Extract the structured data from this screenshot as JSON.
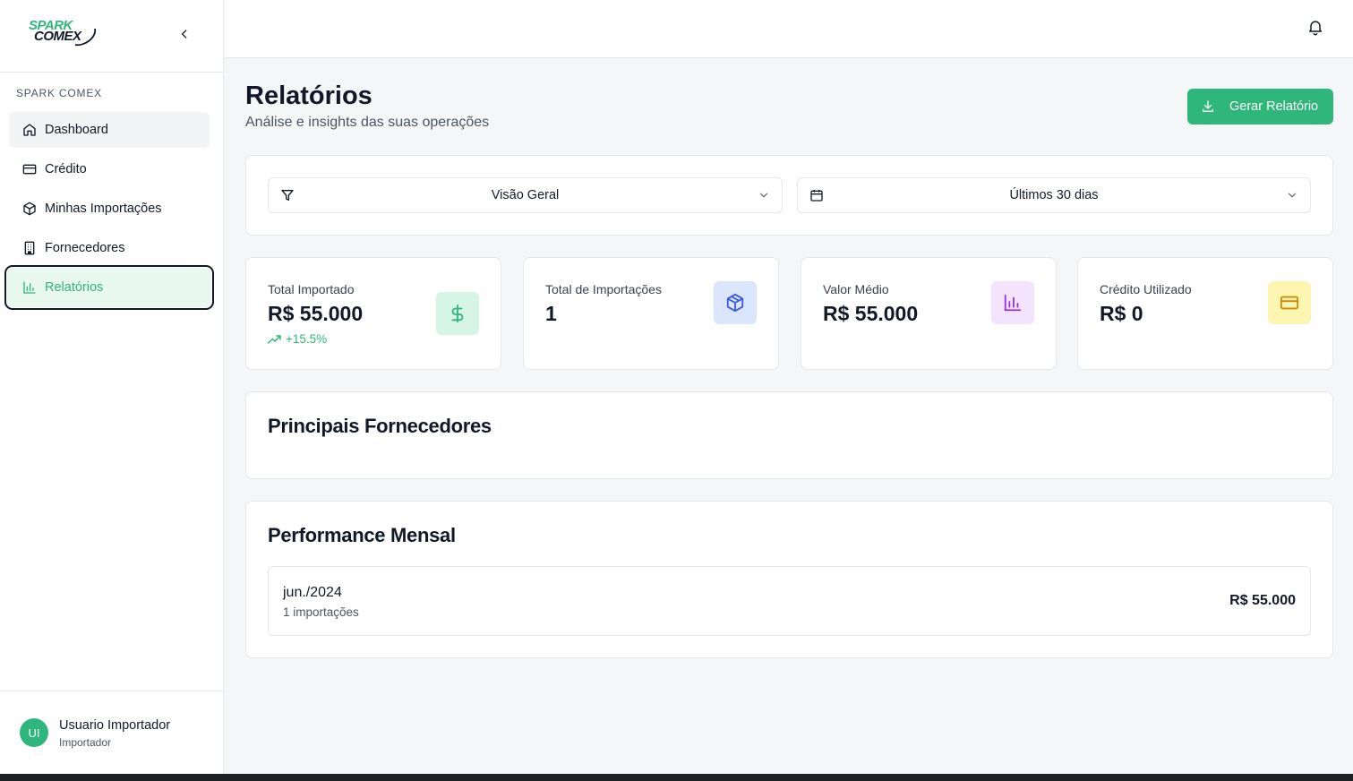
{
  "sidebar": {
    "logo": {
      "line1": "SPARK",
      "line2": "COMEX"
    },
    "section_label": "SPARK COMEX",
    "items": [
      {
        "label": "Dashboard",
        "icon": "home-icon"
      },
      {
        "label": "Crédito",
        "icon": "credit-card-icon"
      },
      {
        "label": "Minhas Importações",
        "icon": "package-icon"
      },
      {
        "label": "Fornecedores",
        "icon": "building-icon"
      },
      {
        "label": "Relatórios",
        "icon": "bar-chart-icon",
        "active": true
      }
    ],
    "user": {
      "initials": "UI",
      "name": "Usuario Importador",
      "role": "Importador"
    }
  },
  "header": {
    "title": "Relatórios",
    "subtitle": "Análise e insights das suas operações",
    "generate_label": "Gerar Relatório"
  },
  "filters": {
    "view": "Visão Geral",
    "period": "Últimos 30 dias"
  },
  "stats": [
    {
      "label": "Total Importado",
      "value": "R$ 55.000",
      "trend": "+15.5%",
      "icon": "dollar-icon",
      "color": "#d6f5e5"
    },
    {
      "label": "Total de Importações",
      "value": "1",
      "icon": "package-icon",
      "color": "#dbe6fd"
    },
    {
      "label": "Valor Médio",
      "value": "R$ 55.000",
      "icon": "bar-chart-icon",
      "color": "#f3e3fc"
    },
    {
      "label": "Crédito Utilizado",
      "value": "R$ 0",
      "icon": "credit-card-icon",
      "color": "#fdf6b2"
    }
  ],
  "suppliers": {
    "title": "Principais Fornecedores"
  },
  "performance": {
    "title": "Performance Mensal",
    "rows": [
      {
        "month": "jun./2024",
        "count": "1 importações",
        "value": "R$ 55.000"
      }
    ]
  },
  "colors": {
    "accent": "#2fb67a",
    "text": "#111827",
    "muted": "#4b5563"
  }
}
